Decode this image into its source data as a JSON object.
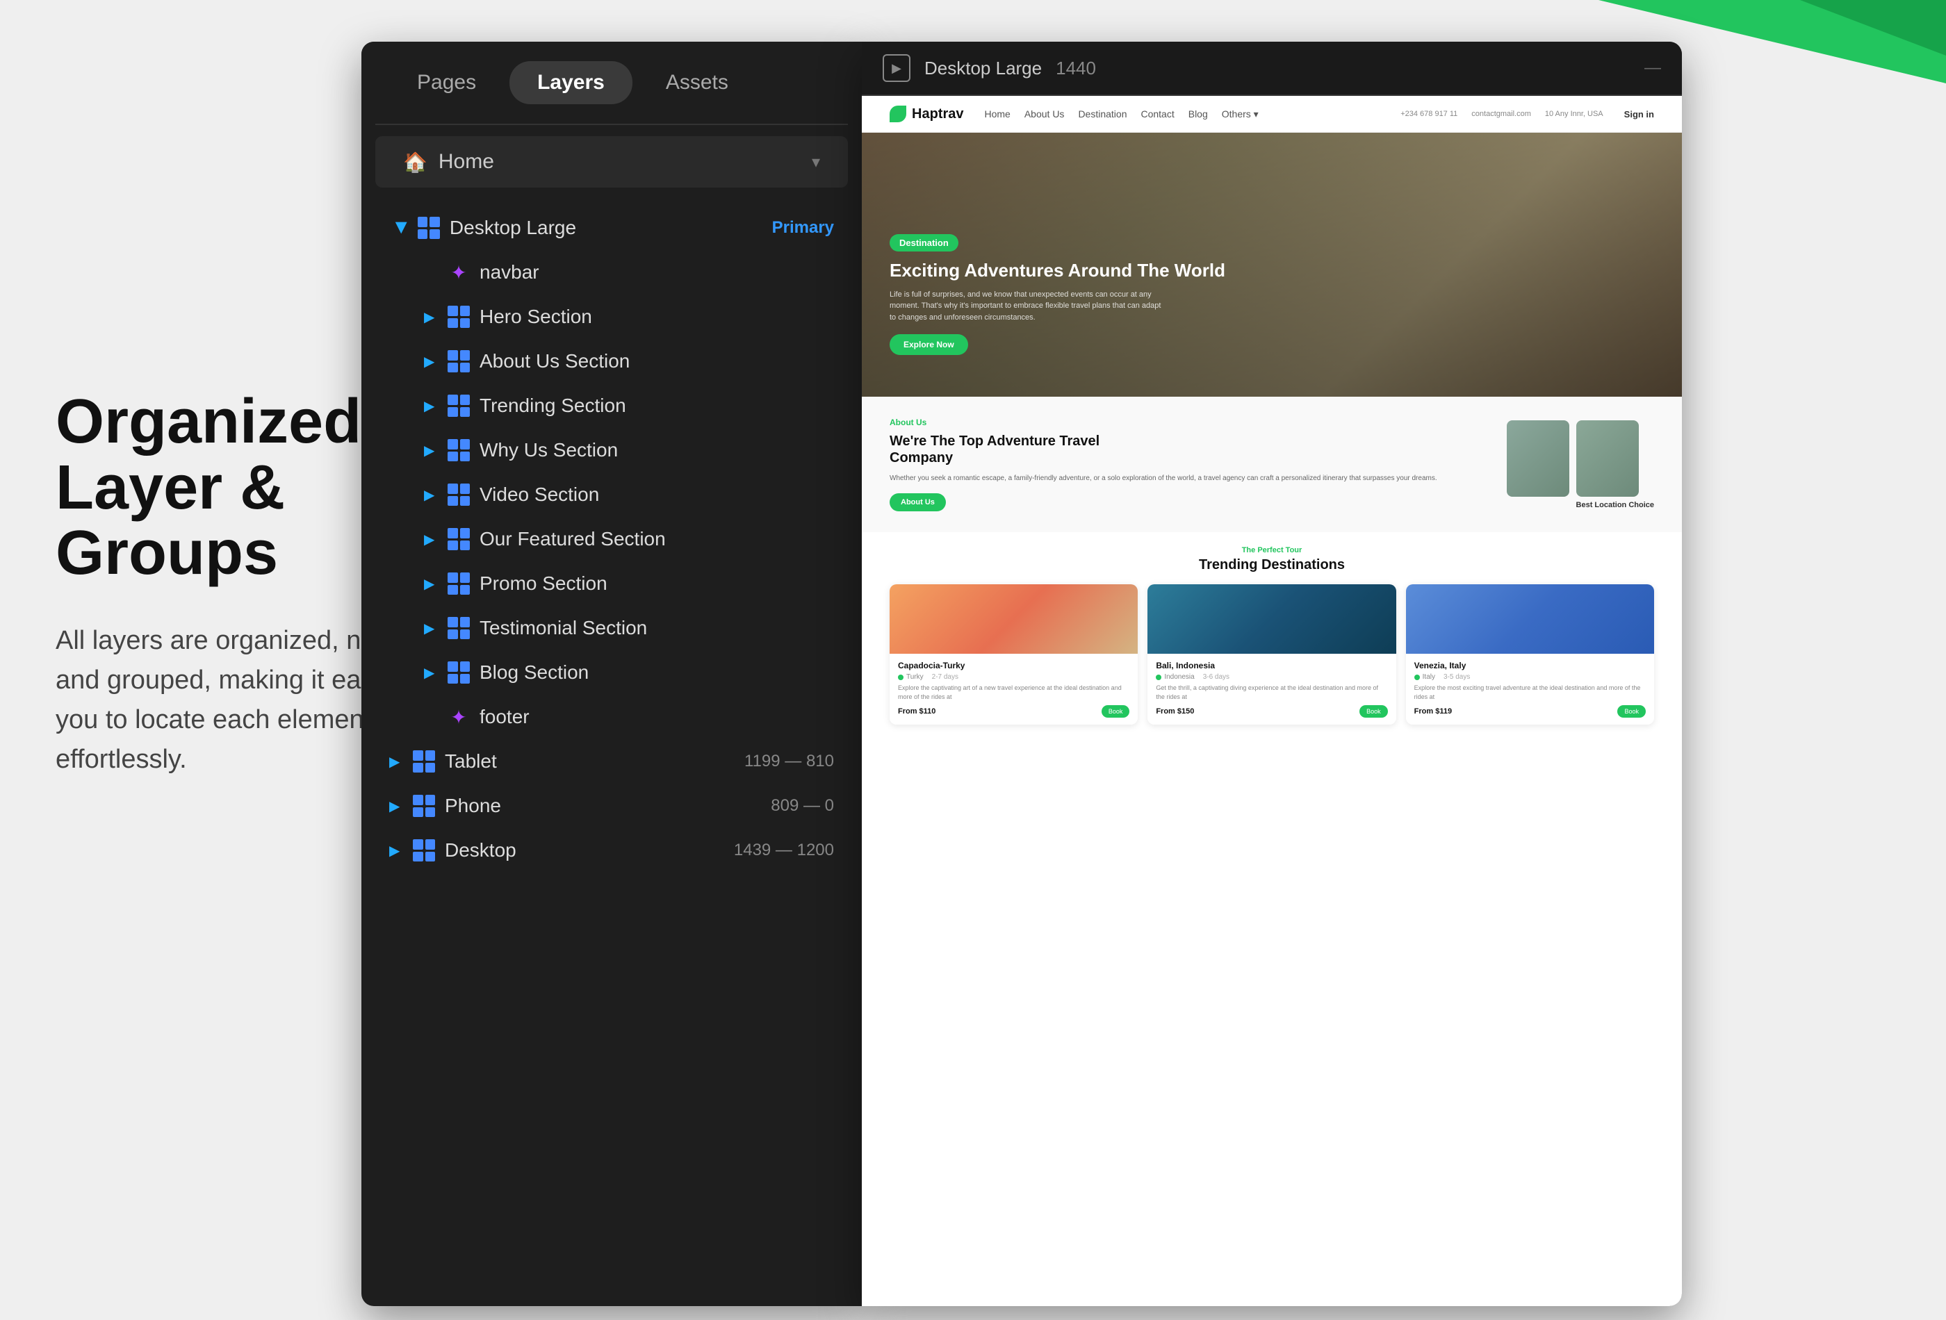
{
  "background": {
    "color": "#efefef"
  },
  "left_content": {
    "title_line1": "Organized",
    "title_line2": "Layer & Groups",
    "subtitle": "All layers are organized, named, and grouped, making it easy for you to locate each element effortlessly."
  },
  "panel": {
    "tabs": [
      "Pages",
      "Layers",
      "Assets"
    ],
    "active_tab": "Layers",
    "home_label": "Home",
    "desktop_large": {
      "name": "Desktop Large",
      "badge": "Primary",
      "layers": [
        {
          "name": "navbar",
          "icon": "sparkle",
          "indent": 2
        },
        {
          "name": "Hero Section",
          "icon": "grid",
          "indent": 2,
          "has_arrow": true
        },
        {
          "name": "About Us Section",
          "icon": "grid",
          "indent": 2,
          "has_arrow": true
        },
        {
          "name": "Trending Section",
          "icon": "grid",
          "indent": 2,
          "has_arrow": true
        },
        {
          "name": "Why Us Section",
          "icon": "grid",
          "indent": 2,
          "has_arrow": true
        },
        {
          "name": "Video Section",
          "icon": "grid",
          "indent": 2,
          "has_arrow": true
        },
        {
          "name": "Our Featured Section",
          "icon": "grid",
          "indent": 2,
          "has_arrow": true
        },
        {
          "name": "Promo Section",
          "icon": "grid",
          "indent": 2,
          "has_arrow": true
        },
        {
          "name": "Testimonial Section",
          "icon": "grid",
          "indent": 2,
          "has_arrow": true
        },
        {
          "name": "Blog Section",
          "icon": "grid",
          "indent": 2,
          "has_arrow": true
        },
        {
          "name": "footer",
          "icon": "sparkle",
          "indent": 2
        }
      ]
    },
    "tablet": {
      "name": "Tablet",
      "size": "1199 — 810"
    },
    "phone": {
      "name": "Phone",
      "size": "809 — 0"
    },
    "desktop": {
      "name": "Desktop",
      "size": "1439 — 1200"
    }
  },
  "preview": {
    "device_label": "Desktop Large",
    "width": "1440",
    "navbar": {
      "logo": "Haptrav",
      "links": [
        "Home",
        "About Us",
        "Destination",
        "Contact",
        "Blog",
        "Others"
      ],
      "right_items": [
        "Phone",
        "Email",
        "Other"
      ],
      "phone": "+234 678 917 11",
      "email": "contactgmail.com",
      "other": "10 Any Innr, USA",
      "signin": "Sign in"
    },
    "hero": {
      "badge": "Destination",
      "title": "Exciting Adventures Around The World",
      "description": "Life is full of surprises, and we know that unexpected events can occur at any moment. That's why it's important to embrace flexible travel plans that can adapt to changes and unforeseen circumstances.",
      "button": "Explore Now"
    },
    "about": {
      "label": "About Us",
      "title_line1": "We're The Top Adventure Travel",
      "title_line2": "Company",
      "description": "Whether you seek a romantic escape, a family-friendly adventure, or a solo exploration of the world, a travel agency can craft a personalized itinerary that surpasses your dreams.",
      "button": "About Us",
      "caption": "Best Location Choice"
    },
    "trending": {
      "label": "The Perfect Tour",
      "title": "Trending Destinations",
      "cards": [
        {
          "name": "Capadocia-Turky",
          "location": "Turky",
          "duration": "2-7days",
          "description": "Explore the captivating art of a new travel experience at the ideal destination and more of the rides at",
          "price": "From",
          "price_value": "$110",
          "btn": "Book"
        },
        {
          "name": "Bali, Indonesia",
          "location": "Indonesia",
          "duration": "3-6days",
          "description": "Get the thrill, a captivating diving experience at the ideal destination and more of the rides at",
          "price": "From",
          "price_value": "$150",
          "btn": "Book"
        },
        {
          "name": "Venezia, Italy",
          "location": "Italy",
          "duration": "3-5 days",
          "description": "Explore the most exciting travel adventure at the ideal destination and more of the rides at",
          "price": "From",
          "price_value": "$119",
          "btn": "Book"
        }
      ]
    }
  }
}
